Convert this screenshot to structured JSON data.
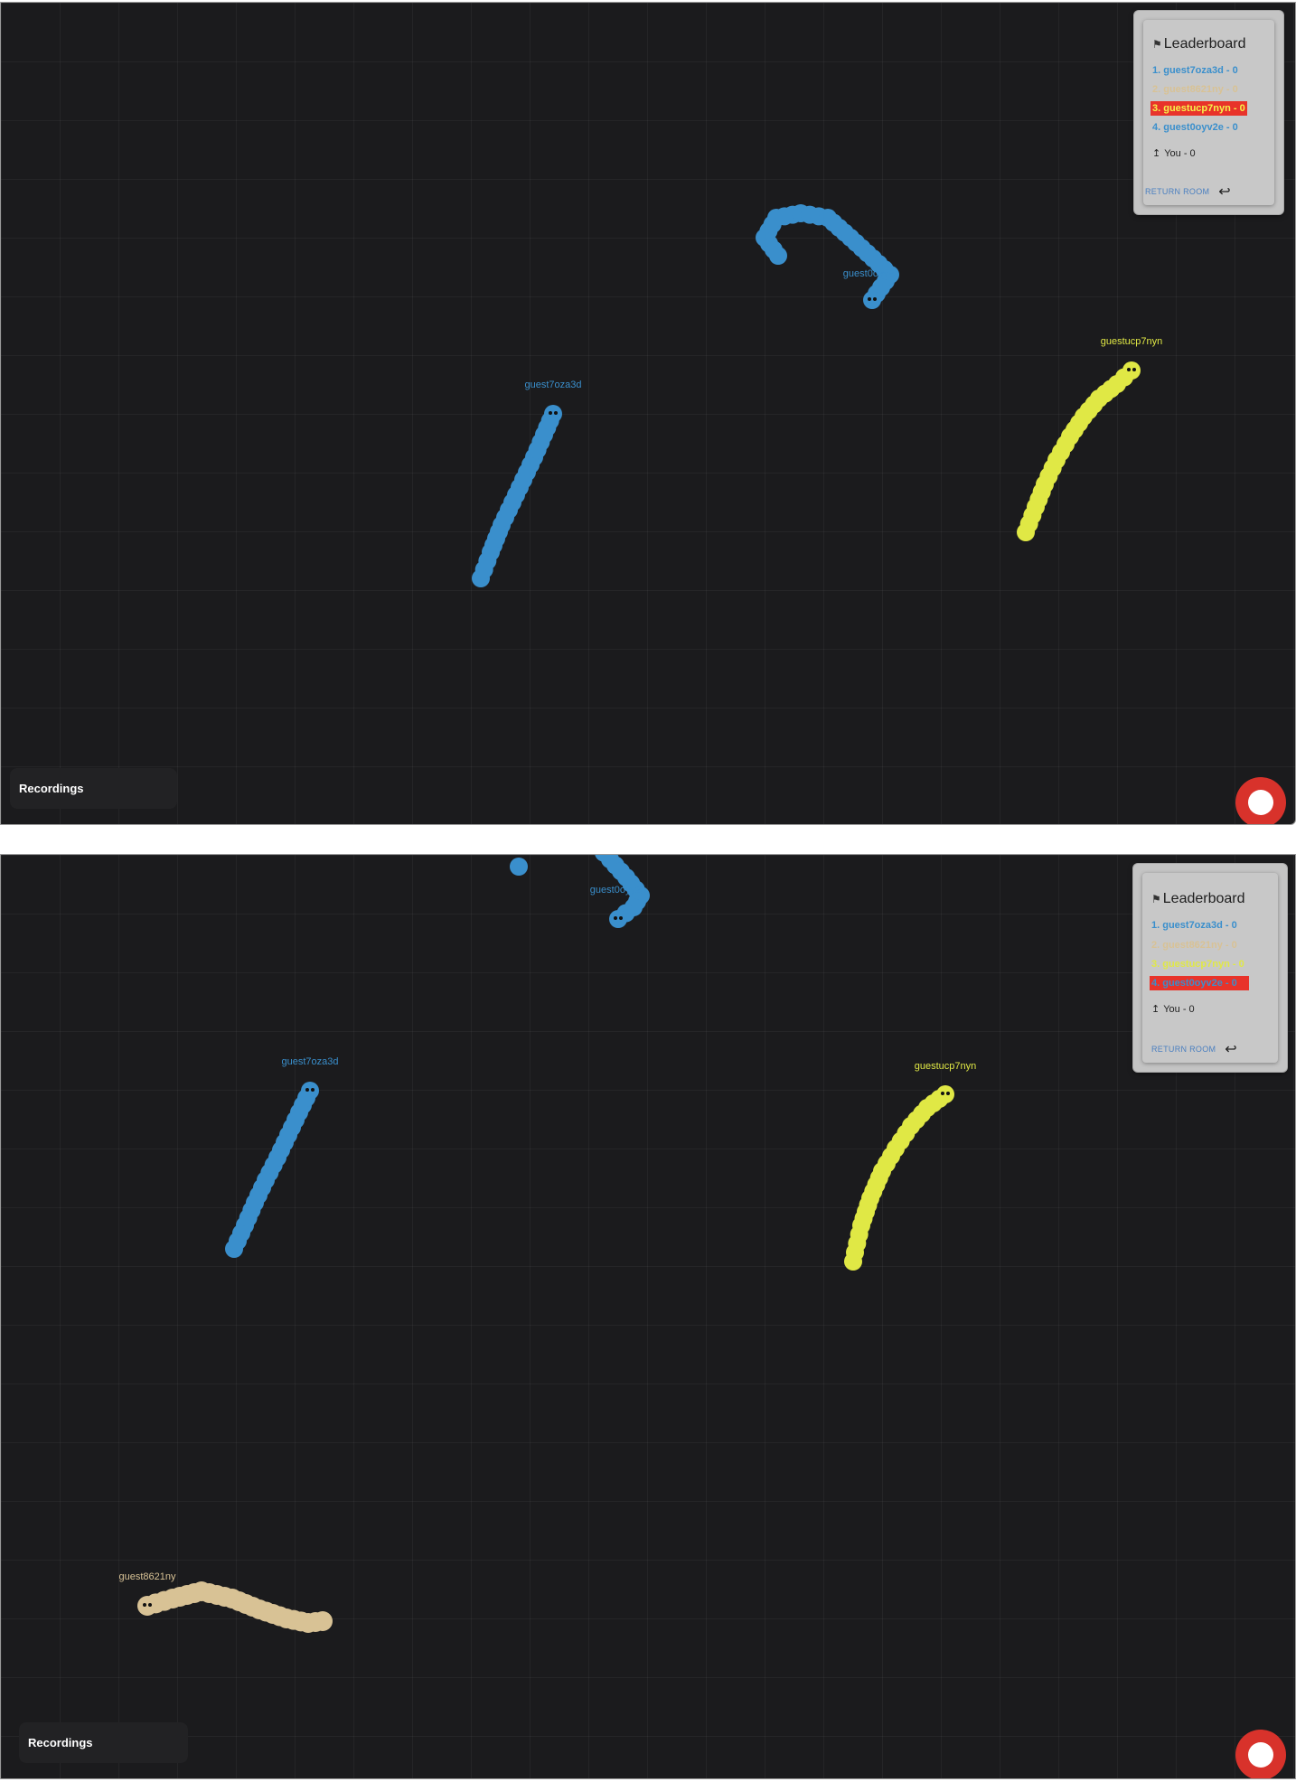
{
  "colors": {
    "blue": "#3a8fcc",
    "yellow": "#e0e845",
    "tan": "#d8c295",
    "highlight": "#e8332a",
    "record": "#d8322b"
  },
  "screens": [
    {
      "leaderboard": {
        "title": "Leaderboard",
        "flag_icon": "checkered-flag-icon",
        "entries": [
          {
            "text": "1. guest7oza3d - 0",
            "color": "#3a8fcc",
            "highlighted": false
          },
          {
            "text": "2. guest8621ny - 0",
            "color": "#d8c295",
            "highlighted": false
          },
          {
            "text": "3. guestucp7nyn - 0",
            "color": "#f6f24a",
            "highlighted": true
          },
          {
            "text": "4. guest0oyv2e - 0",
            "color": "#3a8fcc",
            "highlighted": false
          }
        ],
        "you": "You - 0",
        "you_icon": "arrow-up-icon",
        "return_label": "RETURN ROOM",
        "return_icon": "return-arrow-icon"
      },
      "recordings_label": "Recordings",
      "record_icon": "record-icon",
      "snakes": [
        {
          "name": "guest0oyv2e",
          "label": "guest0oyv2e",
          "color": "#3a8fcc"
        },
        {
          "name": "guest7oza3d",
          "label": "guest7oza3d",
          "color": "#3a8fcc"
        },
        {
          "name": "guestucp7nyn",
          "label": "guestucp7nyn",
          "color": "#e0e845"
        }
      ]
    },
    {
      "leaderboard": {
        "title": "Leaderboard",
        "flag_icon": "checkered-flag-icon",
        "entries": [
          {
            "text": "1. guest7oza3d - 0",
            "color": "#3a8fcc",
            "highlighted": false
          },
          {
            "text": "2. guest8621ny - 0",
            "color": "#d8c295",
            "highlighted": false
          },
          {
            "text": "3. guestucp7nyn - 0",
            "color": "#e0e845",
            "highlighted": false
          },
          {
            "text": "4. guest0oyv2e - 0",
            "color": "#3a8fcc",
            "highlighted": true
          }
        ],
        "you": "You - 0",
        "you_icon": "arrow-up-icon",
        "return_label": "RETURN ROOM",
        "return_icon": "return-arrow-icon"
      },
      "recordings_label": "Recordings",
      "record_icon": "record-icon",
      "snakes": [
        {
          "name": "guest0oyv2e",
          "label": "guest0oyv2e",
          "color": "#3a8fcc"
        },
        {
          "name": "guest7oza3d",
          "label": "guest7oza3d",
          "color": "#3a8fcc"
        },
        {
          "name": "guestucp7nyn",
          "label": "guestucp7nyn",
          "color": "#e0e845"
        },
        {
          "name": "guest8621ny",
          "label": "guest8621ny",
          "color": "#d8c295"
        }
      ]
    }
  ]
}
